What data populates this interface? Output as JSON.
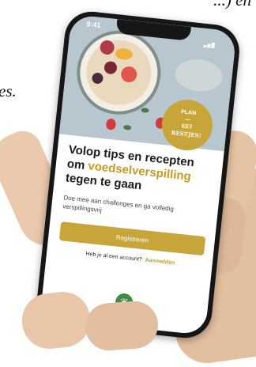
{
  "background": {
    "top_text": "...) en",
    "middle_text": "es."
  },
  "app": {
    "status_time": "9:41",
    "badge": {
      "line1": "PLAN",
      "line2": "—",
      "line3": "EET",
      "line4": "RESTJES!"
    },
    "headline_part1": "Volop tips en recepten om ",
    "headline_accent": "voedselverspilling",
    "headline_part2": " tegen te gaan",
    "subtext": "Doe mee aan challenges en ga volledig verspillingsvrij",
    "register_label": "Registreren",
    "account_question": "Heb je al een account?",
    "login_label": "Aanmelden",
    "logo_icon": "leaf-icon"
  },
  "colors": {
    "accent": "#c8a53b",
    "logo": "#3d8c47"
  }
}
